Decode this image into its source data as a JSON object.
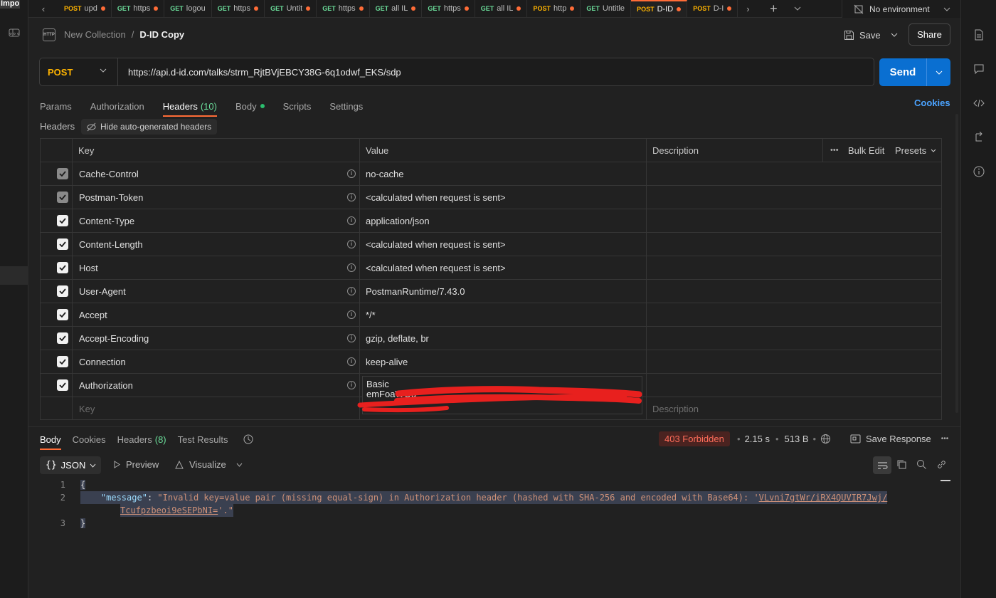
{
  "topbar": {
    "import_label": "Import",
    "tabs": [
      {
        "method": "POST",
        "title": "upd",
        "dot": true,
        "active": false
      },
      {
        "method": "GET",
        "title": "https",
        "dot": true,
        "active": false
      },
      {
        "method": "GET",
        "title": "logou",
        "dot": false,
        "active": false
      },
      {
        "method": "GET",
        "title": "https",
        "dot": true,
        "active": false
      },
      {
        "method": "GET",
        "title": "Untit",
        "dot": true,
        "active": false
      },
      {
        "method": "GET",
        "title": "https",
        "dot": true,
        "active": false
      },
      {
        "method": "GET",
        "title": "all IL",
        "dot": true,
        "active": false
      },
      {
        "method": "GET",
        "title": "https",
        "dot": true,
        "active": false
      },
      {
        "method": "GET",
        "title": "all IL",
        "dot": true,
        "active": false
      },
      {
        "method": "POST",
        "title": "http",
        "dot": true,
        "active": false
      },
      {
        "method": "GET",
        "title": "Untitle",
        "dot": false,
        "active": false
      },
      {
        "method": "POST",
        "title": "D-ID",
        "dot": true,
        "active": true
      },
      {
        "method": "POST",
        "title": "D-I",
        "dot": true,
        "active": false
      }
    ],
    "environment": "No environment"
  },
  "header": {
    "icon_text": "HTTP",
    "collection": "New Collection",
    "separator": "/",
    "request_name": "D-ID Copy",
    "save_label": "Save",
    "share_label": "Share"
  },
  "request": {
    "method": "POST",
    "url": "https://api.d-id.com/talks/strm_RjtBVjEBCY38G-6q1odwf_EKS/sdp",
    "send_label": "Send"
  },
  "request_tabs": [
    {
      "label": "Params",
      "active": false
    },
    {
      "label": "Authorization",
      "active": false
    },
    {
      "label": "Headers",
      "count": "(10)",
      "active": true
    },
    {
      "label": "Body",
      "dot": true,
      "active": false
    },
    {
      "label": "Scripts",
      "active": false
    },
    {
      "label": "Settings",
      "active": false
    }
  ],
  "cookies_label": "Cookies",
  "headers_section": {
    "label": "Headers",
    "hide_auto_label": "Hide auto-generated headers",
    "columns": {
      "key": "Key",
      "value": "Value",
      "description": "Description"
    },
    "bulk_edit": "Bulk Edit",
    "presets": "Presets",
    "rows": [
      {
        "key": "Cache-Control",
        "value": "no-cache",
        "checked": true,
        "disabled": true
      },
      {
        "key": "Postman-Token",
        "value": "<calculated when request is sent>",
        "checked": true,
        "disabled": true
      },
      {
        "key": "Content-Type",
        "value": "application/json",
        "checked": true,
        "disabled": false
      },
      {
        "key": "Content-Length",
        "value": "<calculated when request is sent>",
        "checked": true,
        "disabled": false
      },
      {
        "key": "Host",
        "value": "<calculated when request is sent>",
        "checked": true,
        "disabled": false
      },
      {
        "key": "User-Agent",
        "value": "PostmanRuntime/7.43.0",
        "checked": true,
        "disabled": false
      },
      {
        "key": "Accept",
        "value": "*/*",
        "checked": true,
        "disabled": false
      },
      {
        "key": "Accept-Encoding",
        "value": "gzip, deflate, br",
        "checked": true,
        "disabled": false
      },
      {
        "key": "Connection",
        "value": "keep-alive",
        "checked": true,
        "disabled": false
      },
      {
        "key": "Authorization",
        "value": "Basic",
        "value_line2": "emFoaWQu",
        "checked": true,
        "disabled": false
      }
    ],
    "key_placeholder": "Key",
    "description_placeholder": "Description"
  },
  "response": {
    "tabs": [
      {
        "label": "Body",
        "active": true
      },
      {
        "label": "Cookies",
        "active": false
      },
      {
        "label": "Headers",
        "count": "(8)",
        "active": false
      },
      {
        "label": "Test Results",
        "active": false
      }
    ],
    "status": "403 Forbidden",
    "time": "2.15 s",
    "size": "513 B",
    "save_response": "Save Response",
    "format": "JSON",
    "preview_label": "Preview",
    "visualize_label": "Visualize",
    "body_lines": [
      {
        "n": "1",
        "text": "{"
      },
      {
        "n": "2",
        "key": "\"message\"",
        "colon": ": ",
        "string": "\"Invalid key=value pair (missing equal-sign) in Authorization header (hashed with SHA-256 and encoded with Base64): 'VLvni7gtWr/iRX4QUVIR7Jwj/",
        "link": "VLvni7gtWr/iRX4QUVIR7Jwj/"
      },
      {
        "n": "",
        "string_cont": "Tcufpzbeoi9eSEPbNI=",
        "tail": "'.\""
      },
      {
        "n": "3",
        "text": "}"
      }
    ]
  },
  "colors": {
    "accent": "#ff6c37",
    "send": "#0a6fd1",
    "get": "#6bdd9a",
    "post": "#ffb400",
    "error": "#ff6d5a",
    "link": "#4ba3ff"
  }
}
